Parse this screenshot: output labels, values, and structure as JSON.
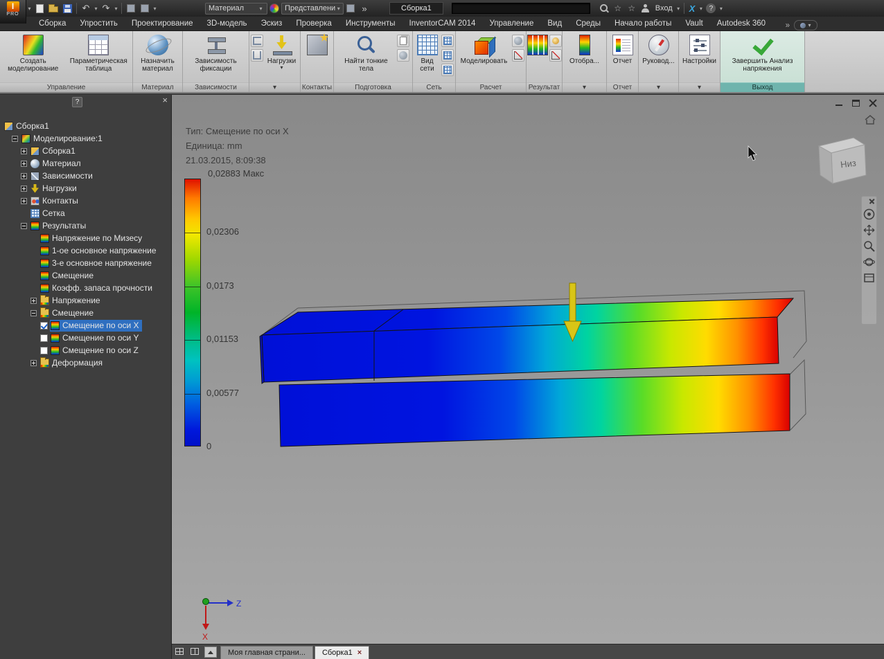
{
  "titlebar": {
    "pro": "PRO",
    "material_combo": "Материал",
    "view_combo": "Представлени",
    "doc_title": "Сборка1",
    "search_value": "",
    "signin": "Вход",
    "brand_x": "X",
    "help": "?"
  },
  "glyphs": {
    "dd": "▾",
    "overflow": "»",
    "undo": "↶",
    "redo": "↷",
    "close": "×",
    "help": "?"
  },
  "ribbon_tabs": [
    "Сборка",
    "Упростить",
    "Проектирование",
    "3D-модель",
    "Эскиз",
    "Проверка",
    "Инструменты",
    "InventorCAM 2014",
    "Управление",
    "Вид",
    "Среды",
    "Начало работы",
    "Vault",
    "Autodesk 360"
  ],
  "ribbon": {
    "buttons": {
      "create_sim": "Создать моделирование",
      "param_table": "Параметрическая таблица",
      "assign_material": "Назначить материал",
      "fix_constraint": "Зависимость фиксации",
      "loads": "Нагрузки",
      "find_thin": "Найти тонкие тела",
      "mesh_view": "Вид сети",
      "simulate": "Моделировать",
      "display": "Отобра...",
      "report": "Отчет",
      "guide": "Руковод...",
      "settings": "Настройки",
      "finish": "Завершить Анализ напряжения"
    },
    "panel_labels": {
      "manage": "Управление",
      "material": "Материал",
      "constraints": "Зависимости",
      "loads": "▾",
      "contacts": "Контакты",
      "prepare": "Подготовка",
      "mesh": "Сеть",
      "solve": "Расчет",
      "result": "Результат",
      "display": "▾",
      "report": "Отчет",
      "guide": "▾",
      "settings": "▾",
      "exit": "Выход"
    }
  },
  "browser": {
    "help": "?",
    "close": "×",
    "tree": [
      "Сборка1",
      "Моделирование:1",
      "Сборка1",
      "Материал",
      "Зависимости",
      "Нагрузки",
      "Контакты",
      "Сетка",
      "Результаты",
      "Напряжение по Мизесу",
      "1-ое основное напряжение",
      "3-е основное напряжение",
      "Смещение",
      "Коэфф. запаса прочности",
      "Напряжение",
      "Смещение",
      "Смещение по оси X",
      "Смещение по оси Y",
      "Смещение по оси Z",
      "Деформация"
    ]
  },
  "viewport": {
    "info_type": "Тип: Смещение по оси X",
    "info_unit": "Единица: mm",
    "info_time": "21.03.2015, 8:09:38",
    "legend": {
      "max": "0,02883 Макс",
      "ticks": [
        "0,02306",
        "0,0173",
        "0,01153",
        "0,00577",
        "0"
      ]
    },
    "viewcube": "Низ",
    "axes": {
      "z": "Z",
      "x": "X"
    }
  },
  "doc_t": {
    "home": "Моя главная страни...",
    "active": "Сборка1"
  },
  "colors": {
    "selection": "#2f6fc0",
    "exit_panel": "#6fb4ad",
    "legend_max": "#e01800",
    "legend_min": "#0030d8"
  }
}
